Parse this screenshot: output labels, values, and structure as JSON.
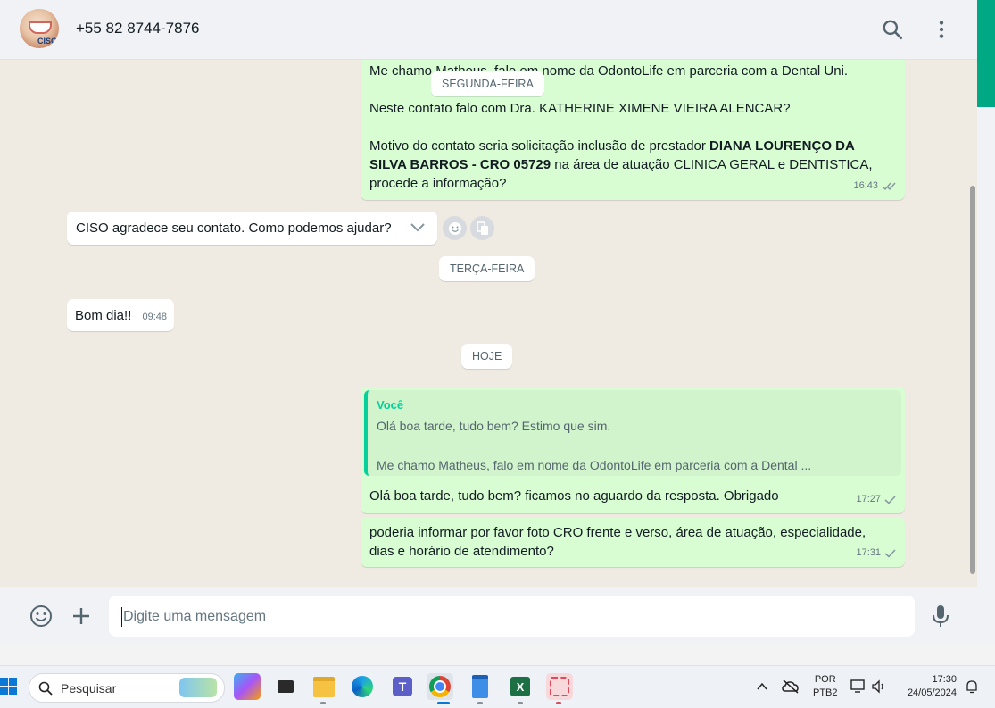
{
  "header": {
    "contact_name": "+55 82 8744-7876",
    "avatar_label": "CISO"
  },
  "messages": {
    "out1": {
      "line1": "Me chamo Matheus, falo em nome da OdontoLife em parceria com a Dental Uni.",
      "line2": "Neste contato falo com Dra. KATHERINE XIMENE VIEIRA ALENCAR?",
      "line3_a": "Motivo do contato seria  solicitação inclusão de prestador ",
      "line3_b": "DIANA LOURENÇO DA",
      "line4_b": "SILVA BARROS - CRO 05729",
      "line4_a": " na área de atuação CLINICA GERAL e DENTISTICA,",
      "line5": "procede a informação?",
      "time": "16:43"
    },
    "day1": "SEGUNDA-FEIRA",
    "in1": {
      "text": "CISO agradece seu contato. Como podemos ajudar?"
    },
    "day2": "TERÇA-FEIRA",
    "in2": {
      "text": "Bom dia!!",
      "time": "09:48"
    },
    "day3": "HOJE",
    "out2": {
      "quote_author": "Você",
      "quote_line1": "Olá boa tarde, tudo bem? Estimo que sim.",
      "quote_line2": "Me chamo Matheus, falo em nome da OdontoLife em parceria com a Dental ...",
      "text": "Olá boa tarde, tudo bem? ficamos no aguardo da resposta. Obrigado",
      "time": "17:27"
    },
    "out3": {
      "line1": "poderia informar por favor foto CRO frente e verso, área de atuação, especialidade,",
      "line2": "dias e horário de atendimento?",
      "time": "17:31"
    }
  },
  "composer": {
    "placeholder": "Digite uma mensagem"
  },
  "taskbar": {
    "search_label": "Pesquisar",
    "lang_line1": "POR",
    "lang_line2": "PTB2",
    "time": "17:30",
    "date": "24/05/2024"
  },
  "colors": {
    "accent": "#00a884",
    "out_bubble": "#d9fdd3",
    "chat_bg": "#efeae2"
  }
}
